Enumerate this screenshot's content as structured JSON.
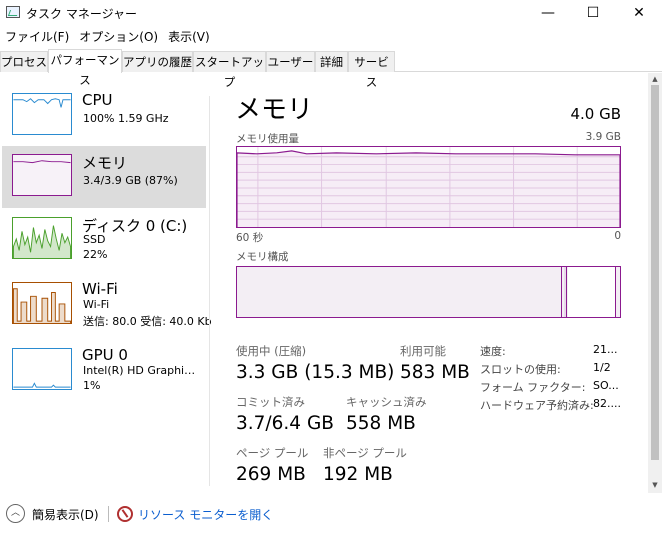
{
  "window": {
    "title": "タスク マネージャー",
    "minimize": "—",
    "maximize": "☐",
    "close": "✕"
  },
  "menu": [
    "ファイル(F)",
    "オプション(O)",
    "表示(V)"
  ],
  "tabs": [
    "プロセス",
    "パフォーマンス",
    "アプリの履歴",
    "スタートアップ",
    "ユーザー",
    "詳細",
    "サービス"
  ],
  "active_tab": "パフォーマンス",
  "sidebar": [
    {
      "title": "CPU",
      "sub1": "100%  1.59 GHz",
      "sub2": "",
      "color": "#2a8bd0"
    },
    {
      "title": "メモリ",
      "sub1": "3.4/3.9 GB (87%)",
      "sub2": "",
      "color": "#8b1a8f"
    },
    {
      "title": "ディスク 0 (C:)",
      "sub1": "SSD",
      "sub2": "22%",
      "color": "#4aa02c"
    },
    {
      "title": "Wi-Fi",
      "sub1": "Wi-Fi",
      "sub2": "送信: 80.0  受信: 40.0 Kb",
      "color": "#a74f01"
    },
    {
      "title": "GPU 0",
      "sub1": "Intel(R) HD Graphi…",
      "sub2": "1%",
      "color": "#2a8bd0"
    }
  ],
  "main": {
    "title": "メモリ",
    "total": "4.0 GB",
    "usage_label": "メモリ使用量",
    "usage_max": "3.9 GB",
    "time_label": "60 秒",
    "time_zero": "0",
    "composition_label": "メモリ構成",
    "composition": {
      "in_use_fraction": 0.84,
      "modified_fraction": 0.01,
      "standby_fraction": 0.13
    },
    "accent_color": "#8b1a8f"
  },
  "stats": {
    "in_use_label": "使用中 (圧縮)",
    "in_use_value": "3.3 GB (15.3 MB)",
    "available_label": "利用可能",
    "available_value": "583 MB",
    "committed_label": "コミット済み",
    "committed_value": "3.7/6.4 GB",
    "cached_label": "キャッシュ済み",
    "cached_value": "558 MB",
    "paged_label": "ページ プール",
    "paged_value": "269 MB",
    "nonpaged_label": "非ページ プール",
    "nonpaged_value": "192 MB"
  },
  "details": [
    {
      "key": "速度:",
      "value": "21..."
    },
    {
      "key": "スロットの使用:",
      "value": "1/2"
    },
    {
      "key": "フォーム ファクター:",
      "value": "SO..."
    },
    {
      "key": "ハードウェア予約済み:",
      "value": "82...."
    }
  ],
  "footer": {
    "collapse_label": "簡易表示(D)",
    "resource_monitor_label": "リソース モニターを開く"
  }
}
